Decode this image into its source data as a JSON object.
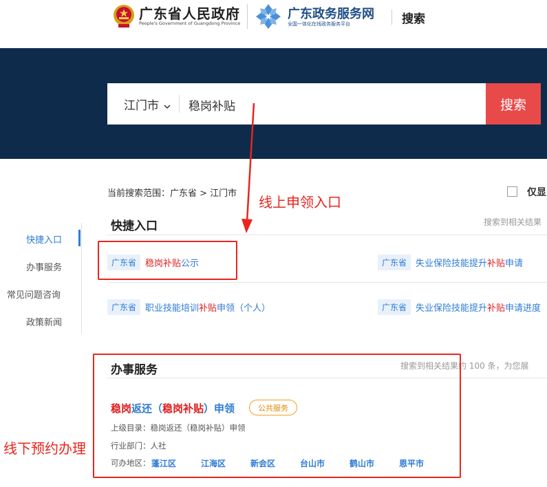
{
  "header": {
    "gov_title": "广东省人民政府",
    "gov_subtitle": "People's Government of Guangdong Province",
    "portal_title": "广东政务服务网",
    "portal_subtitle": "全国一体化在线政务服务平台",
    "search_label": "搜索"
  },
  "search": {
    "city": "江门市",
    "query": "稳岗补贴",
    "button_label": "搜索"
  },
  "scope": {
    "label": "当前搜索范围：广东省 > 江门市",
    "checkbox_label": "仅显"
  },
  "sidebar": {
    "items": [
      {
        "label": "快捷入口",
        "active": true
      },
      {
        "label": "办事服务",
        "active": false
      },
      {
        "label": "常见问题咨询",
        "active": false
      },
      {
        "label": "政策新闻",
        "active": false
      }
    ]
  },
  "quick_entry": {
    "title": "快捷入口",
    "hint": "搜索到相关结果",
    "items": [
      {
        "tag": "广东省",
        "pre": "",
        "hl": "稳岗补贴",
        "post": "公示"
      },
      {
        "tag": "广东省",
        "pre": "失业保险技能提升",
        "hl": "补贴",
        "post": "申请"
      },
      {
        "tag": "广东省",
        "pre": "职业技能培训",
        "hl": "补贴",
        "post": "申领（个人）"
      },
      {
        "tag": "广东省",
        "pre": "失业保险技能提升",
        "hl": "补贴",
        "post": "申请进度"
      }
    ]
  },
  "services": {
    "title": "办事服务",
    "hint": "搜索到相关结果约 100 条，为您展",
    "item": {
      "title_hl1": "稳岗",
      "title_mid": "返还（",
      "title_hl2": "稳岗补贴",
      "title_post": "）申领",
      "badge": "公共服务",
      "parent": "上级目录：稳岗返还（稳岗补贴）申领",
      "dept": "行业部门：人社",
      "regions_label": "可办地区：",
      "regions": [
        "蓬江区",
        "江海区",
        "新会区",
        "台山市",
        "鹤山市",
        "恩平市"
      ]
    }
  },
  "annotations": {
    "online": "线上申领入口",
    "offline": "线下预约办理"
  },
  "colors": {
    "banner": "#0f2b4b",
    "search_button": "#e84a4a",
    "link": "#2e7bd6",
    "highlight": "#e02020",
    "annotation": "#e8251e"
  }
}
